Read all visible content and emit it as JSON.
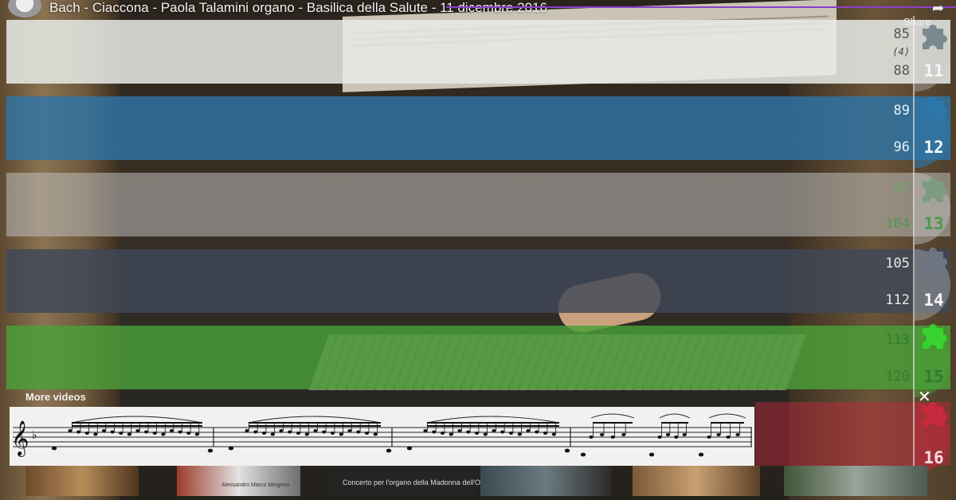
{
  "video": {
    "title": "Bach - Ciaccona - Paola Talamini organo - Basilica della Salute - 11 dicembre 2016",
    "share_label": "Share",
    "share_icon": "share-arrow-icon",
    "channel_avatar": "channel-avatar"
  },
  "measures": {
    "rows": [
      {
        "start": "85",
        "sub": "(4)",
        "end": "88",
        "section": "11",
        "color": "#e8eae6",
        "text_color": "#444444"
      },
      {
        "start": "89",
        "sub": "",
        "end": "96",
        "section": "12",
        "color": "#2d76aa",
        "text_color": "#e8f0f8"
      },
      {
        "start": "97",
        "sub": "",
        "end": "104",
        "section": "13",
        "color": "#bebebc",
        "text_color": "#5aa05a"
      },
      {
        "start": "105",
        "sub": "",
        "end": "112",
        "section": "14",
        "color": "#404858",
        "text_color": "#e8e8e8"
      },
      {
        "start": "113",
        "sub": "",
        "end": "120",
        "section": "15",
        "color": "#4aa038",
        "text_color": "#2e7d2e"
      },
      {
        "start": "",
        "sub": "",
        "end": "",
        "section": "16",
        "color": "#c8283c",
        "text_color": "#f4dde0"
      }
    ],
    "puzzle_icon": "puzzle-piece-icon"
  },
  "more_videos": {
    "label": "More videos",
    "close_icon": "close-icon",
    "thumbnails": [
      {
        "caption": ""
      },
      {
        "caption": "Alessandro Marco Mingrino"
      },
      {
        "caption": "Concerto per l'organo della Madonna dell'Orto"
      },
      {
        "caption": ""
      },
      {
        "caption": ""
      },
      {
        "caption": ""
      }
    ]
  },
  "sheet_music": {
    "clef": "treble-clef-icon",
    "key_signature": "flat-icon"
  }
}
